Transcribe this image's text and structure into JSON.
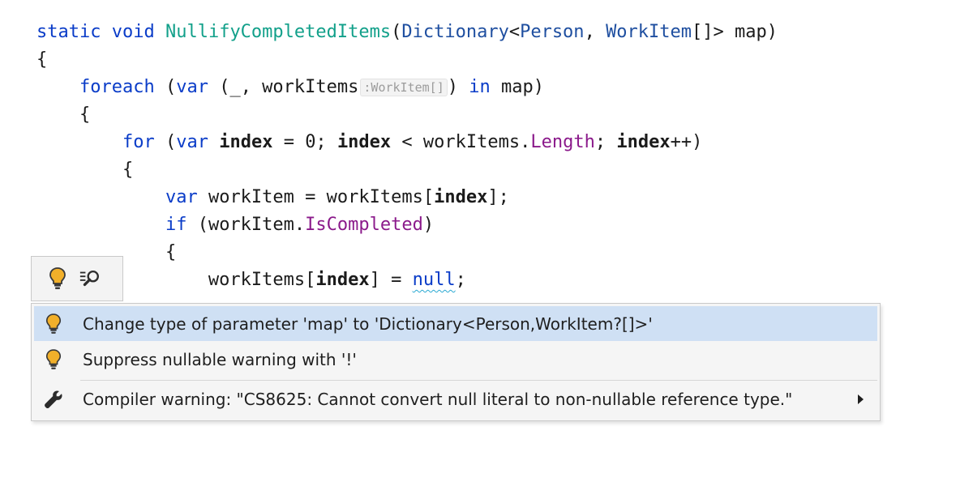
{
  "code": {
    "l1": {
      "kw1": "static",
      "kw2": "void",
      "method": "NullifyCompletedItems",
      "p1": "(",
      "type1": "Dictionary",
      "p2": "<",
      "type2": "Person",
      "p3": ", ",
      "type3": "WorkItem",
      "p4": "[]> map)"
    },
    "l2": "{",
    "l3": {
      "kw1": "foreach",
      "p1": " (",
      "kw2": "var",
      "p2": " (_, workItems",
      "hint": ":WorkItem[]",
      "p3": ") ",
      "kw3": "in",
      "p4": " map)"
    },
    "l4": "{",
    "l5": {
      "kw1": "for",
      "p1": " (",
      "kw2": "var",
      "p2": " ",
      "var1": "index",
      "p3": " = 0; ",
      "var2": "index",
      "p4": " < workItems.",
      "prop": "Length",
      "p5": "; ",
      "var3": "index",
      "p6": "++)"
    },
    "l6": "{",
    "l7": {
      "kw1": "var",
      "p1": " workItem = workItems[",
      "var1": "index",
      "p2": "];"
    },
    "l8": {
      "kw1": "if",
      "p1": " (workItem.",
      "prop": "IsCompleted",
      "p2": ")"
    },
    "l9": "{",
    "l10": {
      "p1": "workItems[",
      "var1": "index",
      "p2": "] = ",
      "kw1": "null",
      "p3": ";"
    }
  },
  "menu": {
    "items": [
      {
        "label": "Change type of parameter 'map' to 'Dictionary<Person,WorkItem?[]>'",
        "icon": "lightbulb-icon"
      },
      {
        "label": "Suppress nullable warning with '!'",
        "icon": "lightbulb-icon"
      },
      {
        "label": "Compiler warning: \"CS8625: Cannot convert null literal to non-nullable reference type.\"",
        "icon": "wrench-icon"
      }
    ]
  },
  "colors": {
    "keyword": "#0a3cc8",
    "method": "#12a08a",
    "property": "#8b1a8b",
    "bulb": "#f2b02a",
    "selection": "#cfe0f4"
  }
}
